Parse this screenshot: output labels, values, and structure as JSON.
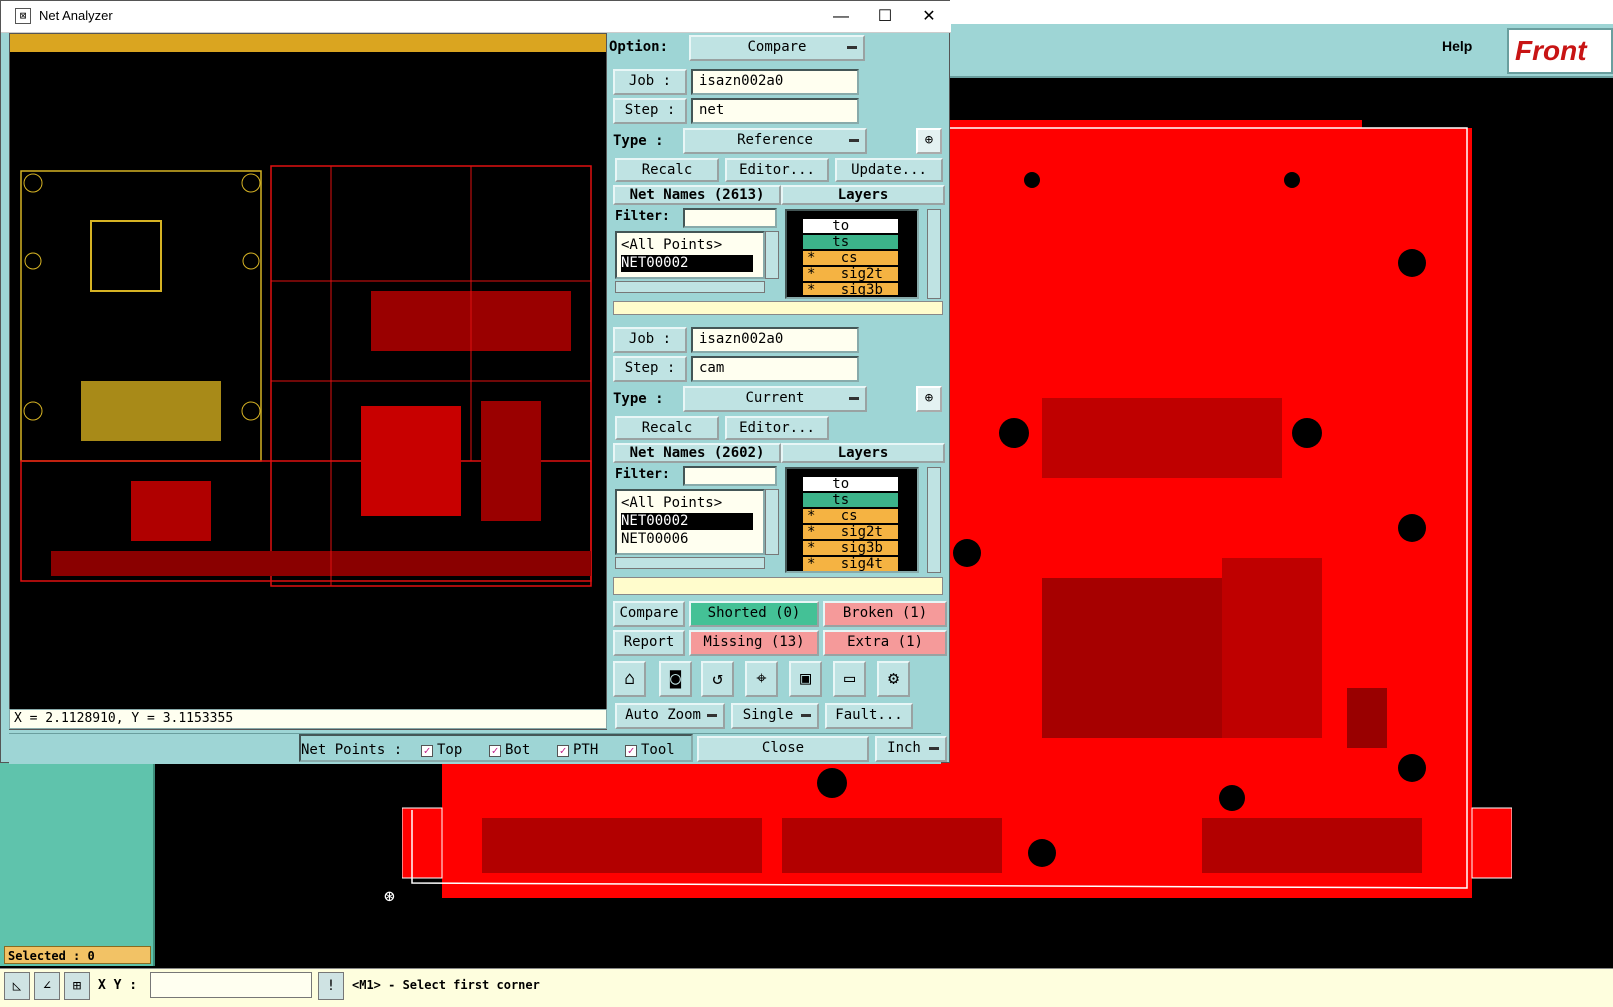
{
  "window": {
    "title": "Net Analyzer"
  },
  "background": {
    "help_label": "Help",
    "logo_text": "Front",
    "selected_label": "Selected : 0",
    "xy_label": "X Y :",
    "status_message": "<M1> - Select first corner"
  },
  "viewer": {
    "coords": "X = 2.1128910, Y = 3.1153355"
  },
  "option": {
    "label": "Option:",
    "value": "Compare"
  },
  "reference": {
    "job_label": "Job  :",
    "job": "isazn002a0",
    "step_label": "Step :",
    "step": "net",
    "type_label": "Type :",
    "type": "Reference",
    "buttons": {
      "recalc": "Recalc",
      "editor": "Editor...",
      "update": "Update..."
    },
    "net_names_header": "Net Names (2613)",
    "layers_header": "Layers",
    "filter_label": "Filter:",
    "nets": [
      "<All Points>",
      "NET00002"
    ],
    "layers": [
      {
        "marker": "",
        "name": "to",
        "color": "#ffffff"
      },
      {
        "marker": "",
        "name": "ts",
        "color": "#3cb38a"
      },
      {
        "marker": "*",
        "name": "cs",
        "color": "#f5b342"
      },
      {
        "marker": "*",
        "name": "sig2t",
        "color": "#f5b342"
      },
      {
        "marker": "*",
        "name": "sig3b",
        "color": "#f5b342"
      }
    ]
  },
  "current": {
    "job_label": "Job  :",
    "job": "isazn002a0",
    "step_label": "Step :",
    "step": "cam",
    "type_label": "Type :",
    "type": "Current",
    "buttons": {
      "recalc": "Recalc",
      "editor": "Editor..."
    },
    "net_names_header": "Net Names (2602)",
    "layers_header": "Layers",
    "filter_label": "Filter:",
    "nets": [
      "<All Points>",
      "NET00002",
      "NET00006"
    ],
    "layers": [
      {
        "marker": "",
        "name": "to",
        "color": "#ffffff"
      },
      {
        "marker": "",
        "name": "ts",
        "color": "#3cb38a"
      },
      {
        "marker": "*",
        "name": "cs",
        "color": "#f5b342"
      },
      {
        "marker": "*",
        "name": "sig2t",
        "color": "#f5b342"
      },
      {
        "marker": "*",
        "name": "sig3b",
        "color": "#f5b342"
      },
      {
        "marker": "*",
        "name": "sig4t",
        "color": "#f5b342"
      }
    ]
  },
  "results": {
    "compare": "Compare",
    "report": "Report",
    "shorted": "Shorted (0)",
    "broken": "Broken (1)",
    "missing": "Missing (13)",
    "extra": "Extra (1)"
  },
  "toolbar_icons": [
    "home-icon",
    "snapshot-icon",
    "undo-icon",
    "pick-net-icon",
    "window-icon",
    "ruler-icon",
    "settings-icon"
  ],
  "bottom": {
    "auto_zoom": "Auto Zoom",
    "single": "Single",
    "fault": "Fault...",
    "net_points_label": "Net Points :",
    "checks": [
      {
        "label": "Top",
        "checked": true
      },
      {
        "label": "Bot",
        "checked": true
      },
      {
        "label": "PTH",
        "checked": true
      },
      {
        "label": "Tool",
        "checked": true
      }
    ],
    "close": "Close",
    "units": "Inch"
  }
}
